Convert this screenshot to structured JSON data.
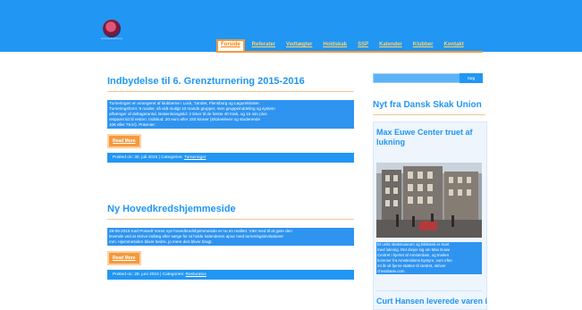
{
  "header": {
    "logo_text": "Grænseklubberne",
    "nav": [
      "Forside",
      "Referater",
      "Vedtægter",
      "Holdskak",
      "SSP",
      "Kalender",
      "Klubber",
      "Kontakt"
    ],
    "active_nav": "Forside"
  },
  "posts": [
    {
      "title": "Indbydelse til 6. Grenzturnering 2015-2016",
      "excerpt_lines": [
        "Turneringen er arrangeret af klubberne i Lock, Tønder, Flensborg og Løgumkloster.",
        "Turneringsform:      9 runder, så vidt muligt 10 mands grupper, men gruppeinddeling og system",
        "afhænger af deltagerantal. Betænkningstid:        2 timer til de første 40 træk, og 15 min plus",
        "resparet tid til resten. Indskud:                     20 euro eller 150 kroner (Skoleelever og studerende",
        "10€ eller 75 kr). Præmier:"
      ],
      "read_more": "Read More",
      "meta_posted": "Posted on: 30. juli 2015",
      "meta_sep": " | ",
      "meta_categories_label": "Categories: ",
      "meta_category": "Turneringer"
    },
    {
      "title": "Ny Hovedkredshjemmeside",
      "excerpt_lines": [
        "28-06-2015 Karl Posselt Vores nye hovedkredshjemmeside er nu en realitet. Vær med til at gøre den",
        "levende ved at skrive indlæg eller sørge for at holde kalenderen ajour med turneringsinvitationer",
        "mm. Hjemmesiden bliver bedre, jo mere den bliver brugt."
      ],
      "read_more": "Read More",
      "meta_posted": "Posted on: 28. juni 2015",
      "meta_sep": " | ",
      "meta_categories_label": "Categories: ",
      "meta_category": "Resturatus"
    }
  ],
  "sidebar": {
    "search_button": "Søg",
    "section_title": "Nyt fra Dansk Skak Union",
    "post_title": "Max Euwe Center truet af lukning",
    "post_excerpt_lines": [
      "Et unikt skakmuseum og bibliotek er truet",
      "med lukning. Det drejer sig om Max Euwe",
      "Centret i hjertet af Amsterdam, og truslen",
      "kommer fra Amsterdams bystyre, som efter",
      "24 år vil fjerne støtten til centret, skriver",
      "chessbase.com"
    ],
    "next_post_title": "Curt Hansen leverede varen i"
  },
  "colors": {
    "header_blue": "#2196f3",
    "accent_orange": "#f39a3d",
    "link_yellow": "#ffd36b"
  }
}
